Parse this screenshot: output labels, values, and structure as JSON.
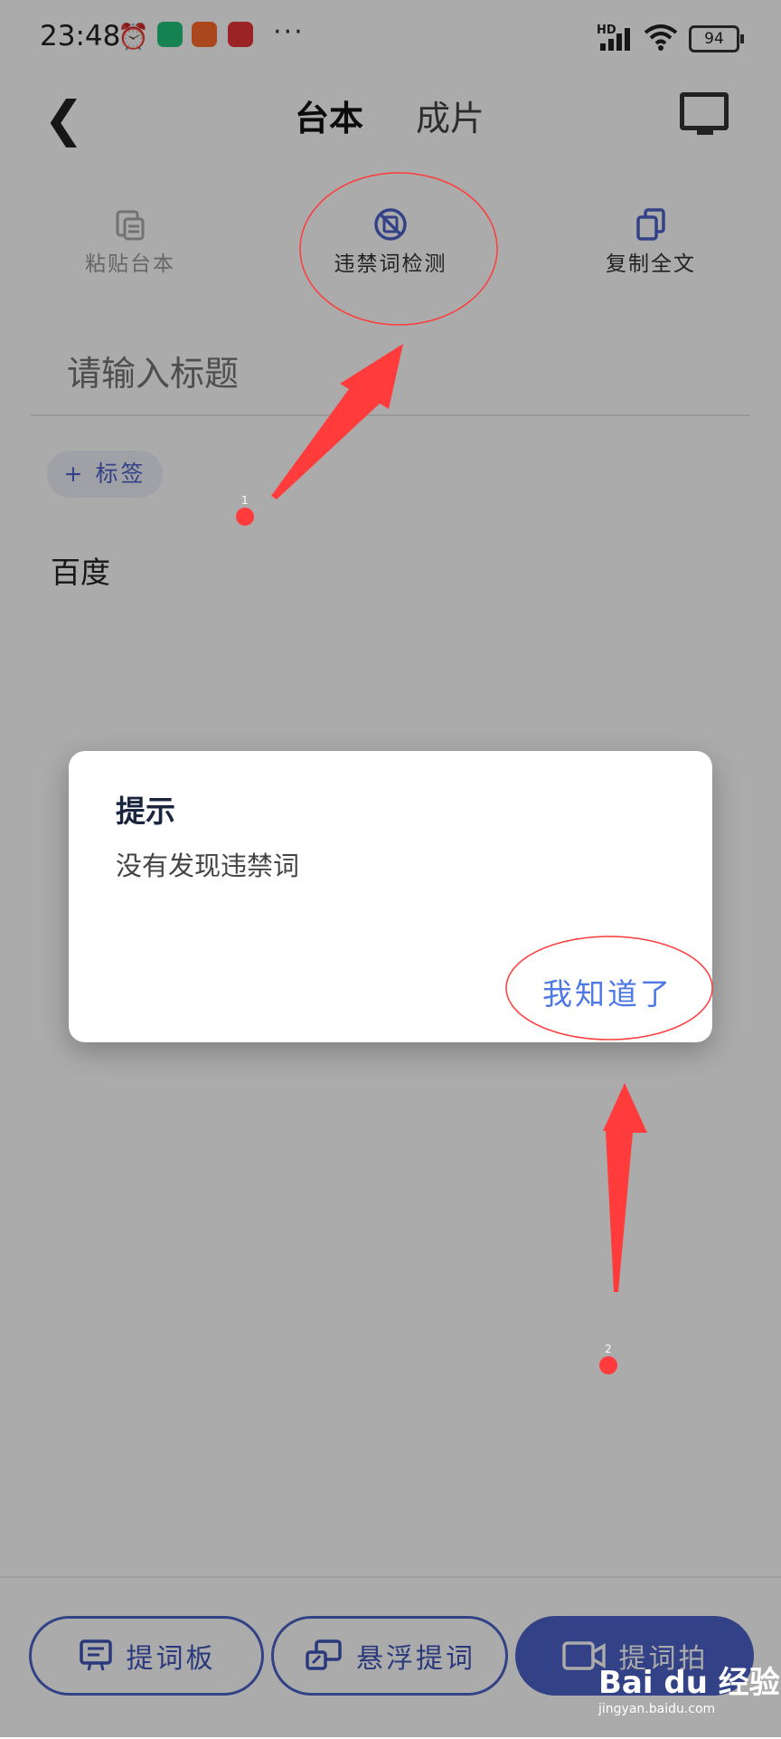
{
  "status_bar": {
    "time": "23:48",
    "battery": "94",
    "network": "HD",
    "more": "···",
    "app_icon_colors": [
      "#21c27a",
      "#ff6a2b",
      "#e8353a"
    ]
  },
  "header": {
    "tabs": [
      {
        "label": "台本",
        "active": true
      },
      {
        "label": "成片",
        "active": false
      }
    ]
  },
  "toolbar": {
    "paste_label": "粘贴台本",
    "check_label": "违禁词检测",
    "copy_label": "复制全文"
  },
  "editor": {
    "title_placeholder": "请输入标题",
    "tag_label": "+ 标签",
    "content": "百度"
  },
  "dialog": {
    "title": "提示",
    "message": "没有发现违禁词",
    "ok_label": "我知道了"
  },
  "bottom_actions": {
    "prompter_label": "提词板",
    "float_label": "悬浮提词",
    "shoot_label": "提词拍"
  },
  "annotations": {
    "step1": "1",
    "step2": "2"
  },
  "watermark": {
    "brand": "Bai du 经验",
    "url": "jingyan.baidu.com"
  },
  "colors": {
    "accent": "#4c63c8",
    "link": "#4e78e6",
    "annotation": "#ff3b3b"
  }
}
